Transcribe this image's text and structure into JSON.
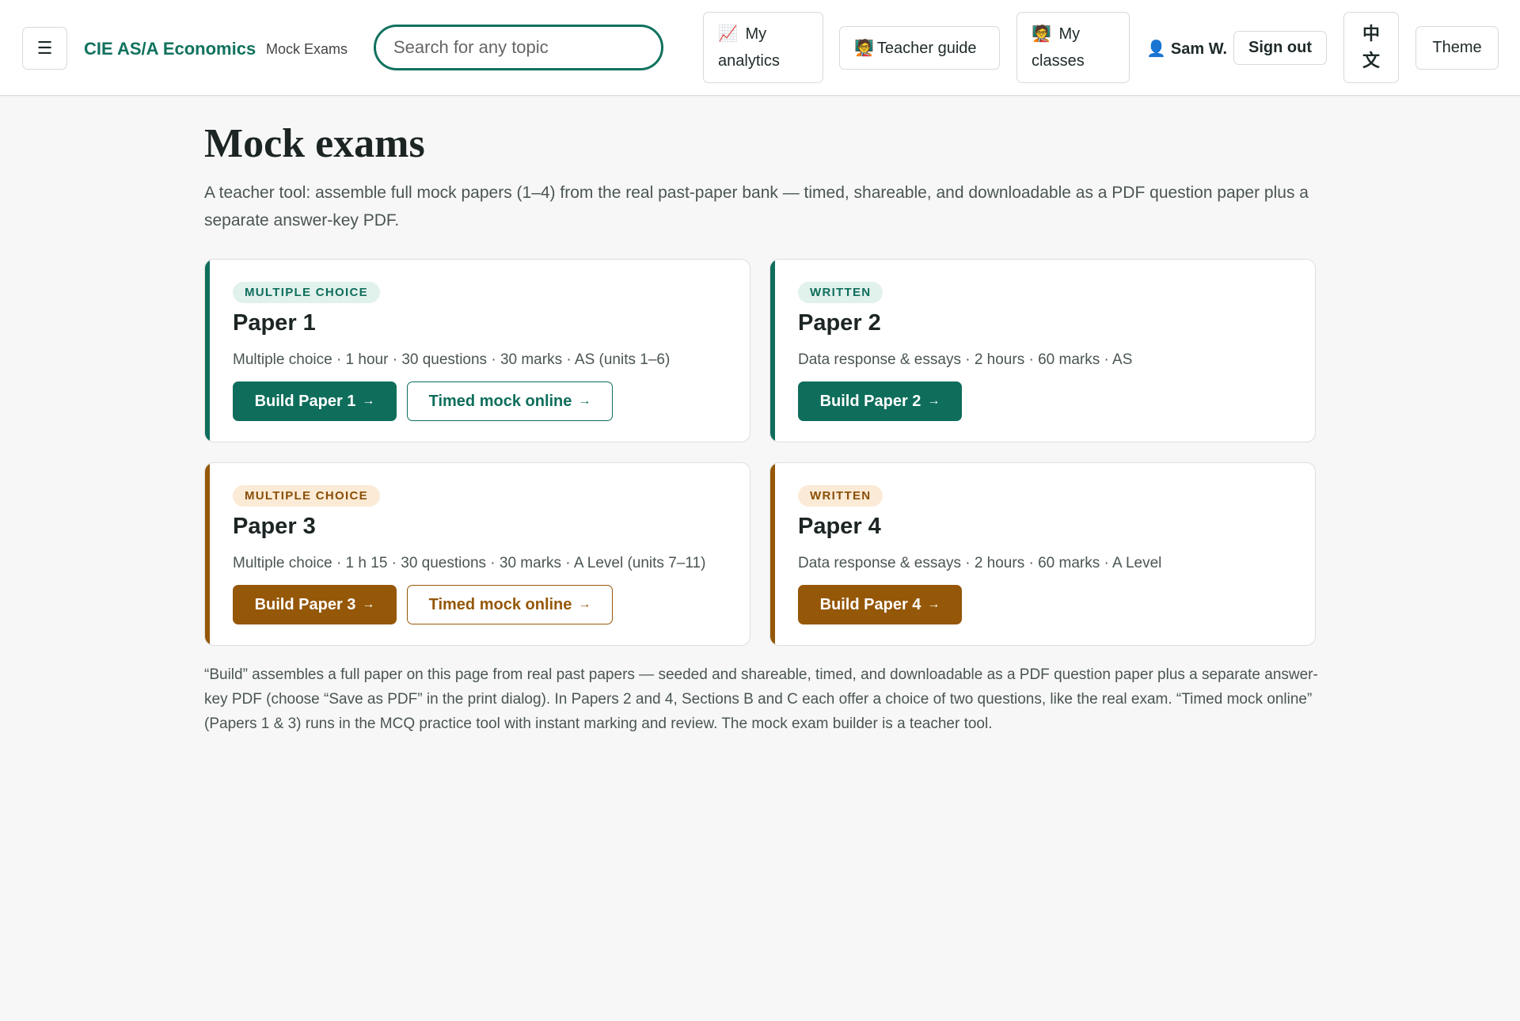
{
  "header": {
    "menu_icon": "☰",
    "brand": "CIE AS/A Economics",
    "brand_sub": "Mock Exams",
    "search_placeholder": "Search for any topic",
    "analytics": {
      "emoji": "📈",
      "label": "My analytics"
    },
    "teacher_guide": {
      "emoji": "🧑‍🏫",
      "label": "Teacher guide"
    },
    "classes": {
      "emoji": "🧑‍🏫",
      "label": "My classes"
    },
    "user": {
      "icon": "👤",
      "name": "Sam W."
    },
    "sign_out": "Sign out",
    "language": "中文",
    "theme": "Theme"
  },
  "main": {
    "title": "Mock exams",
    "intro": "A teacher tool: assemble full mock papers (1–4) from the real past-paper bank — timed, shareable, and downloadable as a PDF question paper plus a separate answer-key PDF.",
    "papers": [
      {
        "badge": "MULTIPLE CHOICE",
        "title": "Paper 1",
        "meta": "Multiple choice · 1 hour · 30 questions · 30 marks · AS (units 1–6)",
        "build_label": "Build Paper 1",
        "timed_label": "Timed mock online",
        "arrow": "→"
      },
      {
        "badge": "WRITTEN",
        "title": "Paper 2",
        "meta": "Data response & essays · 2 hours · 60 marks · AS",
        "build_label": "Build Paper 2",
        "arrow": "→"
      },
      {
        "badge": "MULTIPLE CHOICE",
        "title": "Paper 3",
        "meta": "Multiple choice · 1 h 15 · 30 questions · 30 marks · A Level (units 7–11)",
        "build_label": "Build Paper 3",
        "timed_label": "Timed mock online",
        "arrow": "→"
      },
      {
        "badge": "WRITTEN",
        "title": "Paper 4",
        "meta": "Data response & essays · 2 hours · 60 marks · A Level",
        "build_label": "Build Paper 4",
        "arrow": "→"
      }
    ],
    "footnote": "“Build” assembles a full paper on this page from real past papers — seeded and shareable, timed, and downloadable as a PDF question paper plus a separate answer-key PDF (choose “Save as PDF” in the print dialog). In Papers 2 and 4, Sections B and C each offer a choice of two questions, like the real exam. “Timed mock online” (Papers 1 & 3) runs in the MCQ practice tool with instant marking and review. The mock exam builder is a teacher tool."
  },
  "colors": {
    "as_accent": "#0e6e5b",
    "a_level_accent": "#955708",
    "background": "#f7f7f7"
  }
}
